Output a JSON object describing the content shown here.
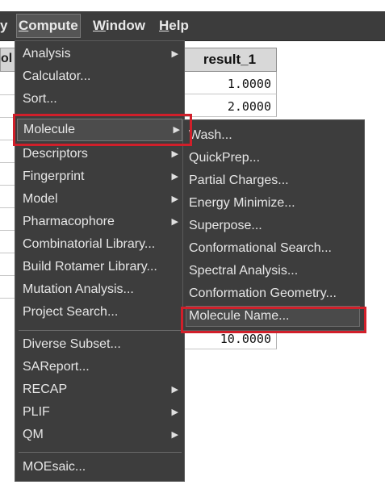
{
  "menubar": {
    "items": [
      {
        "label": "y",
        "active": false
      },
      {
        "label": "Compute",
        "underline": "C",
        "active": true
      },
      {
        "label": "Window",
        "underline": "W",
        "active": false
      },
      {
        "label": "Help",
        "underline": "H",
        "active": false
      }
    ]
  },
  "sheet": {
    "left_header": "ol",
    "column_header": "result_1",
    "values": [
      "1.0000",
      "2.0000",
      "10.0000"
    ]
  },
  "compute_menu": {
    "items": [
      {
        "label": "Analysis",
        "has_submenu": true
      },
      {
        "label": "Calculator...",
        "has_submenu": false
      },
      {
        "label": "Sort...",
        "has_submenu": false
      },
      {
        "label": "Molecule",
        "has_submenu": true,
        "highlighted": true
      },
      {
        "label": "Descriptors",
        "has_submenu": true
      },
      {
        "label": "Fingerprint",
        "has_submenu": true
      },
      {
        "label": "Model",
        "has_submenu": true
      },
      {
        "label": "Pharmacophore",
        "has_submenu": true
      },
      {
        "label": "Combinatorial Library...",
        "has_submenu": false
      },
      {
        "label": "Build Rotamer Library...",
        "has_submenu": false
      },
      {
        "label": "Mutation Analysis...",
        "has_submenu": false
      },
      {
        "label": "Project Search...",
        "has_submenu": false
      },
      {
        "label": "Diverse Subset...",
        "has_submenu": false
      },
      {
        "label": "SAReport...",
        "has_submenu": false
      },
      {
        "label": "RECAP",
        "has_submenu": true
      },
      {
        "label": "PLIF",
        "has_submenu": true
      },
      {
        "label": "QM",
        "has_submenu": true
      },
      {
        "label": "MOEsaic...",
        "has_submenu": false
      }
    ]
  },
  "molecule_submenu": {
    "items": [
      {
        "label": "Wash..."
      },
      {
        "label": "QuickPrep..."
      },
      {
        "label": "Partial Charges..."
      },
      {
        "label": "Energy Minimize..."
      },
      {
        "label": "Superpose..."
      },
      {
        "label": "Conformational Search..."
      },
      {
        "label": "Spectral Analysis..."
      },
      {
        "label": "Conformation Geometry..."
      },
      {
        "label": "Molecule Name...",
        "highlighted": true
      }
    ]
  },
  "icons": {
    "submenu_arrow": "triangle-right-icon"
  },
  "colors": {
    "menu_bg": "#3d3d3d",
    "highlight_box": "#d11f2a",
    "text": "#e6e6e6"
  }
}
